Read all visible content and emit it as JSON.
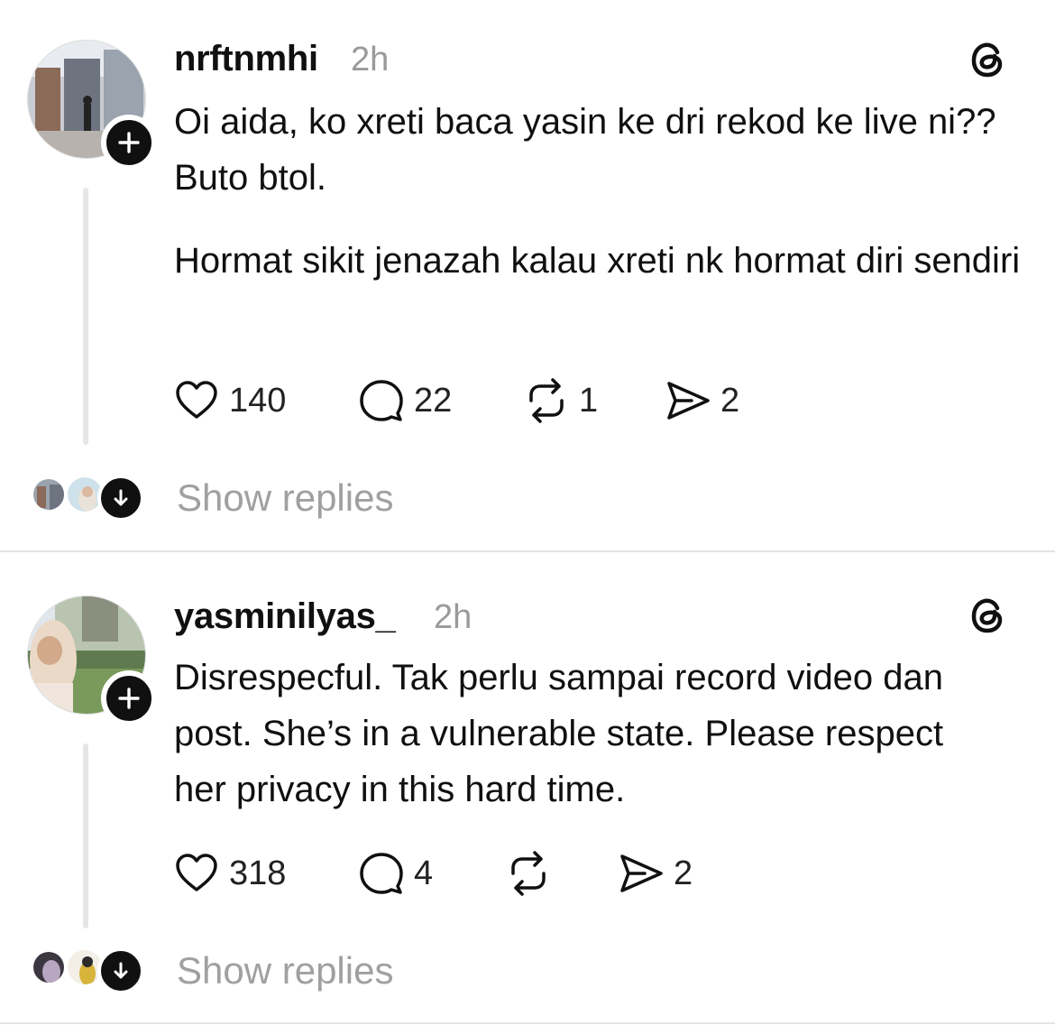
{
  "posts": [
    {
      "username": "nrftnmhi",
      "time": "2h",
      "paragraphs": [
        "Oi aida, ko xreti baca yasin ke dri rekod ke live ni?? Buto btol.",
        "Hormat sikit jenazah kalau xreti nk hormat diri sendiri"
      ],
      "likes": "140",
      "comments": "22",
      "reposts": "1",
      "shares": "2",
      "show_replies": "Show replies"
    },
    {
      "username": "yasminilyas_",
      "time": "2h",
      "paragraphs": [
        "Disrespecful. Tak perlu sampai record video dan post. She’s in a vulnerable state. Please respect her privacy in this hard time."
      ],
      "likes": "318",
      "comments": "4",
      "reposts": "",
      "shares": "2",
      "show_replies": "Show replies"
    }
  ],
  "icons": {
    "like": "heart-icon",
    "comment": "comment-bubble-icon",
    "repost": "repost-icon",
    "share": "send-icon",
    "logo": "threads-logo-icon",
    "follow": "plus-icon",
    "expand": "arrow-down-icon"
  },
  "colors": {
    "text": "#101010",
    "muted": "#9a9a9a",
    "divider": "#e4e4e4"
  }
}
